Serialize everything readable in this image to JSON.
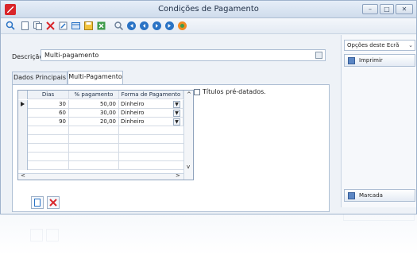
{
  "window": {
    "title": "Condições de Pagamento"
  },
  "controls": {
    "minimize": "–",
    "maximize": "□",
    "close": "✕"
  },
  "toolbar": {
    "icons": [
      "search-icon",
      "new-icon",
      "copy-icon",
      "delete-icon",
      "edit-icon",
      "view-icon",
      "save-icon",
      "export-icon",
      "preview-icon",
      "first-icon",
      "prev-icon",
      "next-icon",
      "last-icon",
      "refresh-icon"
    ]
  },
  "form": {
    "description_label": "Descrição",
    "description_value": "Multi-pagamento",
    "tabs": [
      {
        "label": "Dados Principais",
        "active": false
      },
      {
        "label": "Multi-Pagamento",
        "active": true
      }
    ]
  },
  "grid": {
    "columns": [
      "Dias",
      "% pagamento",
      "Forma de Pagamento"
    ],
    "rows": [
      {
        "dias": "30",
        "pct": "50,00",
        "forma": "Dinheiro"
      },
      {
        "dias": "60",
        "pct": "30,00",
        "forma": "Dinheiro"
      },
      {
        "dias": "90",
        "pct": "20,00",
        "forma": "Dinheiro"
      }
    ],
    "empty_rows": 6
  },
  "checkbox": {
    "label": "Títulos pré-datados.",
    "checked": false
  },
  "side_panel": {
    "dropdown": "Opções deste Ecrã",
    "print_button": "Imprimir",
    "marcada_button": "Marcada"
  },
  "colors": {
    "accent": "#d9262b",
    "toolbar_blue": "#2a73c5",
    "title_bg": "#d7e3f1"
  }
}
